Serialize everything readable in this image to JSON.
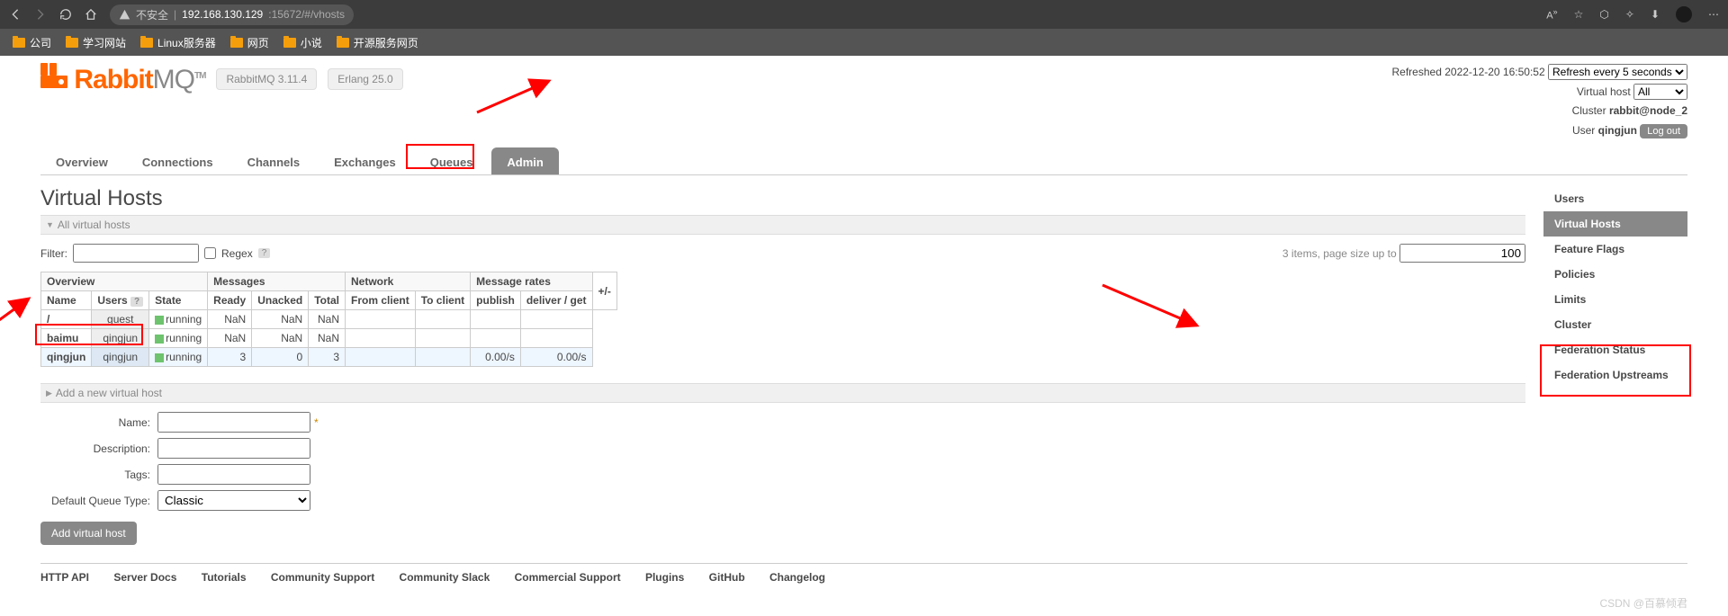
{
  "browser": {
    "security_label": "不安全",
    "url_host": "192.168.130.129",
    "url_path": ":15672/#/vhosts"
  },
  "bookmarks": [
    "公司",
    "学习网站",
    "Linux服务器",
    "网页",
    "小说",
    "开源服务网页"
  ],
  "header": {
    "product": "RabbitMQ",
    "tm": "TM",
    "version": "RabbitMQ 3.11.4",
    "erlang": "Erlang 25.0"
  },
  "status": {
    "refreshed_label": "Refreshed",
    "refreshed_time": "2022-12-20 16:50:52",
    "refresh_select": "Refresh every 5 seconds",
    "vhost_label": "Virtual host",
    "vhost_value": "All",
    "cluster_label": "Cluster",
    "cluster_value": "rabbit@node_2",
    "user_label": "User",
    "user_value": "qingjun",
    "logout": "Log out"
  },
  "nav": [
    "Overview",
    "Connections",
    "Channels",
    "Exchanges",
    "Queues",
    "Admin"
  ],
  "page_title": "Virtual Hosts",
  "sections": {
    "all": "All virtual hosts",
    "add": "Add a new virtual host"
  },
  "filter": {
    "label": "Filter:",
    "regex": "Regex",
    "items_label": "3 items, page size up to",
    "page_size": "100"
  },
  "table": {
    "groups": [
      "Overview",
      "Messages",
      "Network",
      "Message rates",
      "+/-"
    ],
    "cols": [
      "Name",
      "Users",
      "State",
      "Ready",
      "Unacked",
      "Total",
      "From client",
      "To client",
      "publish",
      "deliver / get"
    ],
    "rows": [
      {
        "name": "/",
        "users": "guest",
        "state": "running",
        "ready": "NaN",
        "unacked": "NaN",
        "total": "NaN",
        "from": "",
        "to": "",
        "pub": "",
        "del": ""
      },
      {
        "name": "baimu",
        "users": "qingjun",
        "state": "running",
        "ready": "NaN",
        "unacked": "NaN",
        "total": "NaN",
        "from": "",
        "to": "",
        "pub": "",
        "del": ""
      },
      {
        "name": "qingjun",
        "users": "qingjun",
        "state": "running",
        "ready": "3",
        "unacked": "0",
        "total": "3",
        "from": "",
        "to": "",
        "pub": "0.00/s",
        "del": "0.00/s"
      }
    ]
  },
  "form": {
    "name": "Name:",
    "desc": "Description:",
    "tags": "Tags:",
    "dqt": "Default Queue Type:",
    "dqt_value": "Classic",
    "submit": "Add virtual host"
  },
  "sidebar": [
    "Users",
    "Virtual Hosts",
    "Feature Flags",
    "Policies",
    "Limits",
    "Cluster",
    "Federation Status",
    "Federation Upstreams"
  ],
  "footer": [
    "HTTP API",
    "Server Docs",
    "Tutorials",
    "Community Support",
    "Community Slack",
    "Commercial Support",
    "Plugins",
    "GitHub",
    "Changelog"
  ],
  "watermark": "CSDN @百慕倾君"
}
